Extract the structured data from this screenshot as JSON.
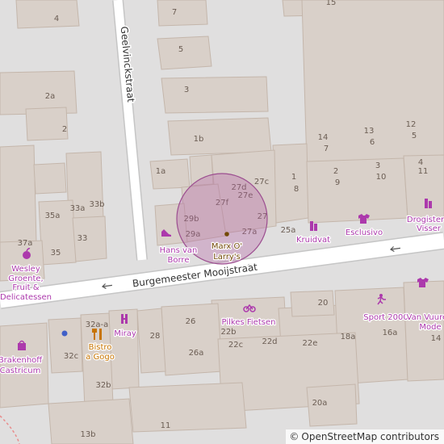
{
  "map": {
    "streets": [
      {
        "name": "Geelvinckstraat"
      },
      {
        "name": "Burgemeester Mooijstraat"
      }
    ],
    "house_numbers": [
      "4",
      "7",
      "15",
      "5",
      "3",
      "2a",
      "2",
      "1b",
      "1a",
      "27d",
      "27e",
      "27c",
      "27f",
      "29b",
      "29a",
      "27",
      "27a",
      "25a",
      "14",
      "7",
      "13",
      "6",
      "12",
      "5",
      "1",
      "8",
      "2",
      "9",
      "3",
      "10",
      "4",
      "11",
      "33a",
      "33b",
      "35a",
      "33",
      "37a",
      "35",
      "20",
      "22b",
      "22c",
      "22d",
      "22e",
      "26",
      "26a",
      "28",
      "32a-a",
      "32c",
      "32b",
      "18a",
      "16a",
      "14",
      "20a",
      "11",
      "13b"
    ],
    "pois": [
      {
        "label": "Hans van Borre",
        "category": "shop",
        "icon": "shoe-icon"
      },
      {
        "label": "Marx O' Larry's",
        "category": "venue",
        "icon": "pub-dot-icon"
      },
      {
        "label": "Kruidvat",
        "category": "shop",
        "icon": "chemist-icon"
      },
      {
        "label": "Esclusivo",
        "category": "shop",
        "icon": "clothes-icon"
      },
      {
        "label": "Drogisterij Visser",
        "display_label": [
          "Drogister",
          "Visser"
        ],
        "category": "shop",
        "icon": "chemist-icon"
      },
      {
        "label": "Wesley Groente, Fruit & Delicatessen",
        "category": "shop",
        "icon": "greengrocer-icon"
      },
      {
        "label": "Brakenhoff Castricum",
        "category": "shop",
        "icon": "bag-icon"
      },
      {
        "label": "Bistro a Gogo",
        "category": "food",
        "icon": "restaurant-icon"
      },
      {
        "label": "Miray",
        "category": "shop",
        "icon": "hairdresser-icon"
      },
      {
        "label": "Pilkes Fietsen",
        "category": "shop",
        "icon": "bicycle-icon"
      },
      {
        "label": "Sport 2000",
        "category": "shop",
        "icon": "sport-icon"
      },
      {
        "label": "Van Vuuren Mode",
        "category": "shop",
        "icon": "clothes-icon"
      }
    ],
    "highlight": {
      "label": "Marx O' Larry's"
    },
    "colors": {
      "background": "#e0dfdf",
      "building": "#d9d0c9",
      "building_outline": "#c4b6ab",
      "road": "#ffffff",
      "road_casing": "#c5c5c5",
      "shop_poi": "#ac39ac",
      "food_poi": "#c77400",
      "venue_poi": "#734a08",
      "highlight_fill": "#b35fa3",
      "marker": "#4060c8"
    }
  },
  "attribution": {
    "symbol": "©",
    "text": "OpenStreetMap contributors"
  }
}
